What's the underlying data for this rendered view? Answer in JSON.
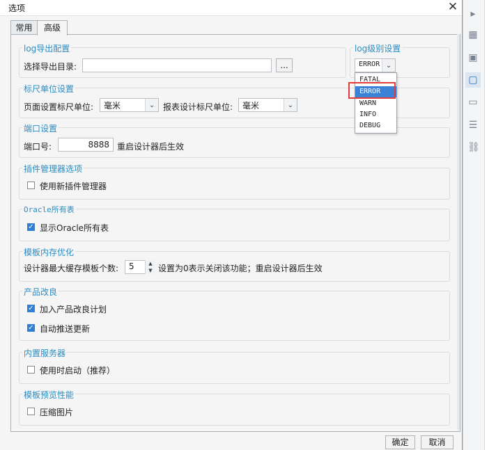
{
  "dialog": {
    "title": "选项",
    "close_glyph": "✕"
  },
  "tabs": [
    {
      "label": "常用"
    },
    {
      "label": "高级"
    }
  ],
  "log_export": {
    "title": "log导出配置",
    "dir_label": "选择导出目录:",
    "dir_value": "",
    "browse_label": "..."
  },
  "log_level": {
    "title": "log级别设置",
    "selected": "ERROR",
    "options": [
      "FATAL",
      "ERROR",
      "WARN",
      "INFO",
      "DEBUG"
    ],
    "highlighted": "ERROR"
  },
  "ruler": {
    "title": "标尺单位设置",
    "page_label": "页面设置标尺单位:",
    "page_value": "毫米",
    "report_label": "报表设计标尺单位:",
    "report_value": "毫米"
  },
  "port": {
    "title": "端口设置",
    "label": "端口号:",
    "value": "8888",
    "note": "重启设计器后生效"
  },
  "plugin": {
    "title": "插件管理器选项",
    "checkbox_label": "使用新插件管理器",
    "checked": false
  },
  "oracle": {
    "title": "Oracle所有表",
    "checkbox_label": "显示Oracle所有表",
    "checked": true
  },
  "cache": {
    "title": "模板内存优化",
    "label": "设计器最大缓存模板个数:",
    "value": "5",
    "note": "设置为0表示关闭该功能；重启设计器后生效"
  },
  "improve": {
    "title": "产品改良",
    "items": [
      {
        "label": "加入产品改良计划",
        "checked": true
      },
      {
        "label": "自动推送更新",
        "checked": true
      }
    ]
  },
  "server": {
    "title": "内置服务器",
    "checkbox_label": "使用时启动（推荐）",
    "checked": false
  },
  "preview": {
    "title": "模板预览性能",
    "checkbox_label": "压缩图片",
    "checked": false
  },
  "footer": {
    "ok_label": "确定",
    "cancel_label": "取消"
  },
  "colors": {
    "accent": "#2d8cc0",
    "selection": "#3a82d6",
    "highlight_box": "#e23b3b",
    "checkbox": "#2e7fd5"
  },
  "right_toolbar": {
    "icons": [
      "play-icon",
      "widget-icon",
      "image-icon",
      "frame-icon",
      "panel-icon",
      "layers-icon",
      "link-icon"
    ]
  }
}
